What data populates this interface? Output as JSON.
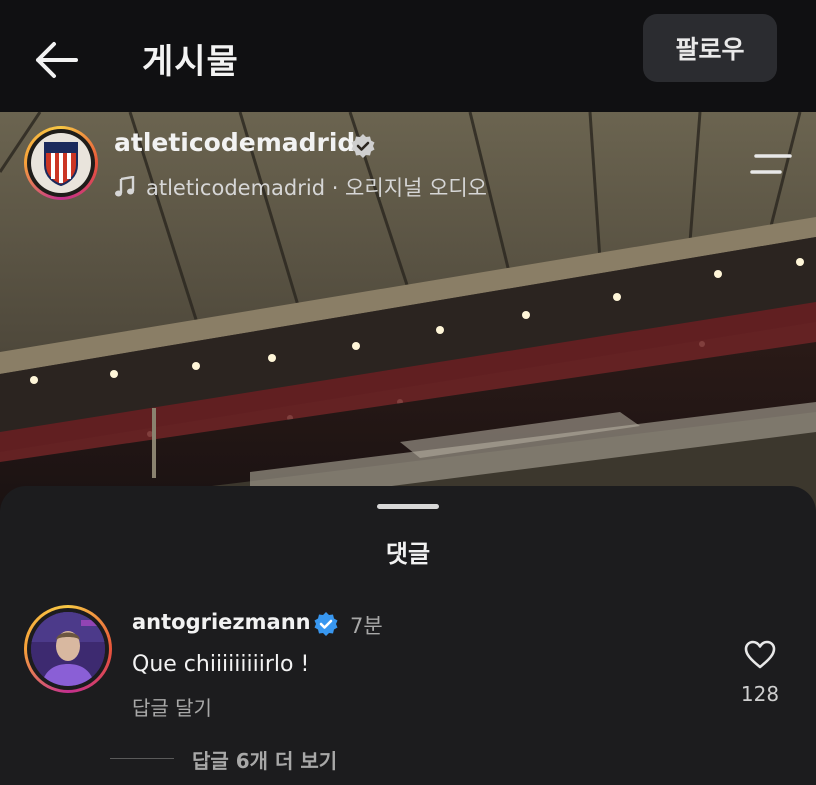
{
  "header": {
    "title": "게시물",
    "follow_label": "팔로우"
  },
  "post": {
    "username": "atleticodemadrid",
    "audio_label": "atleticodemadrid · 오리지널 오디오",
    "verified": true
  },
  "comments_sheet": {
    "title": "댓글",
    "comments": [
      {
        "username": "antogriezmann",
        "verified": true,
        "time": "7분",
        "text": "Que chiiiiiiiiirlo !",
        "reply_label": "답글 달기",
        "likes": "128",
        "more_replies_label": "답글 6개 더 보기"
      }
    ]
  },
  "colors": {
    "background": "#0b0b0c",
    "sheet": "#1c1c1e",
    "follow_button": "#2b2c30",
    "verified_badge": "#3897f0",
    "muted_text": "#a8a8a8"
  },
  "icons": [
    "back-arrow-icon",
    "verified-icon",
    "music-note-icon",
    "menu-icon",
    "heart-icon"
  ]
}
